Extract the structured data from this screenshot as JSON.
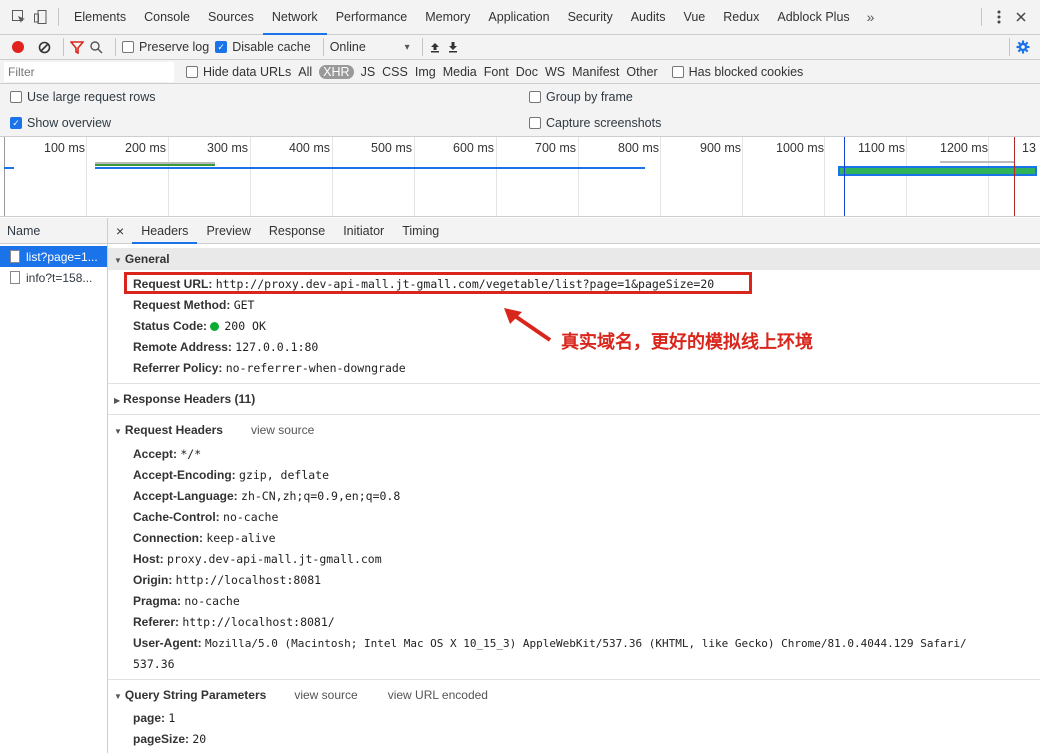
{
  "tabs": [
    "Elements",
    "Console",
    "Sources",
    "Network",
    "Performance",
    "Memory",
    "Application",
    "Security",
    "Audits",
    "Vue",
    "Redux",
    "Adblock Plus"
  ],
  "tabs_more": "»",
  "toolbar": {
    "preserve_log": "Preserve log",
    "disable_cache": "Disable cache",
    "throttle": "Online",
    "throttle_caret": "▾"
  },
  "filter": {
    "placeholder": "Filter",
    "hide_data_urls": "Hide data URLs",
    "types": [
      "All",
      "XHR",
      "JS",
      "CSS",
      "Img",
      "Media",
      "Font",
      "Doc",
      "WS",
      "Manifest",
      "Other"
    ],
    "has_blocked_cookies": "Has blocked cookies"
  },
  "options": {
    "large_rows": "Use large request rows",
    "group_by_frame": "Group by frame",
    "show_overview": "Show overview",
    "capture_screenshots": "Capture screenshots"
  },
  "overview": {
    "ticks": [
      "100 ms",
      "200 ms",
      "300 ms",
      "400 ms",
      "500 ms",
      "600 ms",
      "700 ms",
      "800 ms",
      "900 ms",
      "1000 ms",
      "1100 ms",
      "1200 ms",
      "13"
    ]
  },
  "requests": {
    "header": "Name",
    "items": [
      "list?page=1...",
      "info?t=158..."
    ]
  },
  "details": {
    "close": "×",
    "tabs": [
      "Headers",
      "Preview",
      "Response",
      "Initiator",
      "Timing"
    ],
    "general": {
      "title": "General",
      "rows": [
        {
          "k": "Request URL:",
          "v": "http://proxy.dev-api-mall.jt-gmall.com/vegetable/list?page=1&pageSize=20"
        },
        {
          "k": "Request Method:",
          "v": "GET"
        },
        {
          "k": "Status Code:",
          "v": "200 OK"
        },
        {
          "k": "Remote Address:",
          "v": "127.0.0.1:80"
        },
        {
          "k": "Referrer Policy:",
          "v": "no-referrer-when-downgrade"
        }
      ]
    },
    "response_headers": "Response Headers (11)",
    "request_headers": {
      "title": "Request Headers",
      "view_source": "view source",
      "rows": [
        {
          "k": "Accept:",
          "v": "*/*"
        },
        {
          "k": "Accept-Encoding:",
          "v": "gzip, deflate"
        },
        {
          "k": "Accept-Language:",
          "v": "zh-CN,zh;q=0.9,en;q=0.8"
        },
        {
          "k": "Cache-Control:",
          "v": "no-cache"
        },
        {
          "k": "Connection:",
          "v": "keep-alive"
        },
        {
          "k": "Host:",
          "v": "proxy.dev-api-mall.jt-gmall.com"
        },
        {
          "k": "Origin:",
          "v": "http://localhost:8081"
        },
        {
          "k": "Pragma:",
          "v": "no-cache"
        },
        {
          "k": "Referer:",
          "v": "http://localhost:8081/"
        },
        {
          "k": "User-Agent:",
          "v": "Mozilla/5.0 (Macintosh; Intel Mac OS X 10_15_3) AppleWebKit/537.36 (KHTML, like Gecko) Chrome/81.0.4044.129 Safari/"
        }
      ],
      "ua_wrap": "537.36"
    },
    "query_params": {
      "title": "Query String Parameters",
      "view_source": "view source",
      "view_encoded": "view URL encoded",
      "rows": [
        {
          "k": "page:",
          "v": "1"
        },
        {
          "k": "pageSize:",
          "v": "20"
        }
      ]
    }
  },
  "annotation": "真实域名，更好的模拟线上环境",
  "colors": {
    "accent": "#1a73e8",
    "annotation": "#d9261c",
    "status_ok": "#0bac32"
  }
}
